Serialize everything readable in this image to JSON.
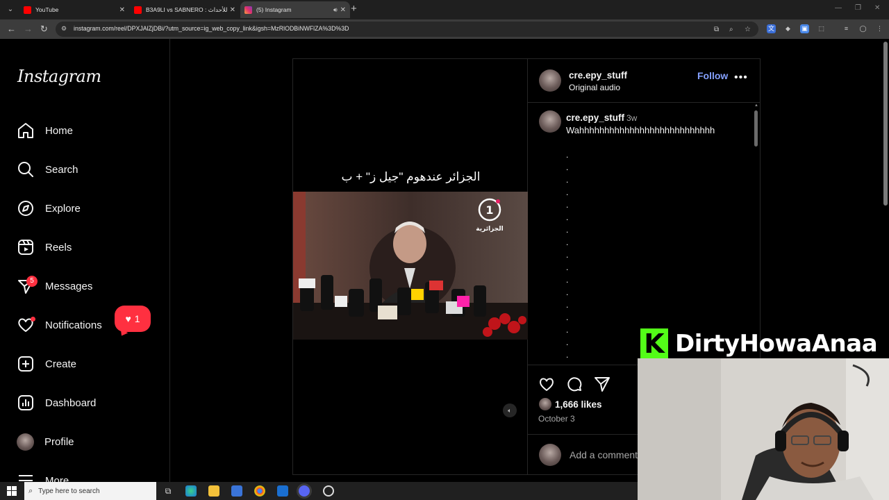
{
  "browser": {
    "tabs": [
      {
        "title": "YouTube",
        "active": false,
        "favicon_color": "#ff0000"
      },
      {
        "title": "B3A9LI vs SABNERO : ‫للأحداث ‬",
        "active": false,
        "favicon_color": "#ff0000"
      },
      {
        "title": "(5) Instagram",
        "active": true,
        "favicon_color": "#e1306c"
      }
    ],
    "url": "instagram.com/reel/DPXJAlZjDBi/?utm_source=ig_web_copy_link&igsh=MzRlODBiNWFlZA%3D%3D"
  },
  "sidebar": {
    "logo": "Instagram",
    "items": [
      {
        "label": "Home",
        "icon": "home-icon"
      },
      {
        "label": "Search",
        "icon": "search-icon"
      },
      {
        "label": "Explore",
        "icon": "compass-icon"
      },
      {
        "label": "Reels",
        "icon": "reels-icon"
      },
      {
        "label": "Messages",
        "icon": "messages-icon",
        "badge": "5"
      },
      {
        "label": "Notifications",
        "icon": "heart-icon"
      },
      {
        "label": "Create",
        "icon": "plus-square-icon"
      },
      {
        "label": "Dashboard",
        "icon": "dashboard-icon"
      },
      {
        "label": "Profile",
        "icon": "avatar"
      },
      {
        "label": "More",
        "icon": "menu-icon"
      }
    ],
    "notification_count": "1"
  },
  "reel": {
    "caption": "الجزائر عندهوم \"جيل ز\" + ب",
    "channel_logo_text": "الجزائرية",
    "channel_logo_number": "1"
  },
  "post": {
    "username": "cre.epy_stuff",
    "audio": "Original audio",
    "follow_label": "Follow",
    "more_label": "•••",
    "comment": {
      "username": "cre.epy_stuff",
      "time": "3w",
      "text": "Wahhhhhhhhhhhhhhhhhhhhhhhhhhh"
    },
    "likes": "1,666 likes",
    "date": "October 3",
    "add_comment_placeholder": "Add a comment..."
  },
  "overlay": {
    "handle": "DirtyHowaAnaa",
    "logo_letter": "K",
    "brand_color": "#53fc18"
  },
  "taskbar": {
    "search_placeholder": "Type here to search"
  }
}
